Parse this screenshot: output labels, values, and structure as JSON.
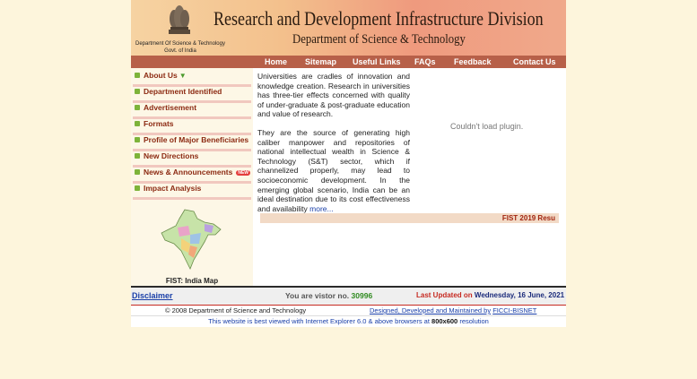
{
  "header": {
    "dept_line1": "Department Of Science & Technology",
    "dept_line2": "Govt. of India",
    "title": "Research and Development Infrastructure Division",
    "subtitle": "Department of Science & Technology"
  },
  "nav": {
    "home": "Home",
    "sitemap": "Sitemap",
    "useful_links": "Useful Links",
    "faqs": "FAQs",
    "feedback": "Feedback",
    "contact": "Contact Us"
  },
  "sidebar": {
    "items": [
      {
        "label": "About Us"
      },
      {
        "label": "Department Identified"
      },
      {
        "label": "Advertisement"
      },
      {
        "label": "Formats"
      },
      {
        "label": "Profile of Major Beneficiaries"
      },
      {
        "label": "New Directions"
      },
      {
        "label": "News & Announcements"
      },
      {
        "label": "Impact Analysis"
      }
    ],
    "new_badge": "NEW",
    "map_label": "FIST: India Map"
  },
  "main": {
    "para1": "Universities are cradles of innovation and knowledge creation. Research in universities has three-tier effects concerned with quality of under-graduate & post-graduate education and value of research.",
    "para2": "They are the source of generating high caliber manpower and repositories of national intellectual wealth in Science & Technology (S&T) sector, which if channelized properly, may lead to socioeconomic development. In the emerging global scenario, India can be an ideal destination due to its cost effectiveness and availability",
    "more": "more...",
    "plugin_msg": "Couldn't load plugin.",
    "ticker": "FIST 2019 Resu"
  },
  "footer": {
    "disclaimer": "Disclaimer",
    "visitor_prefix": "You are vistor no.",
    "visitor_count": "30996",
    "updated_label": "Last Updated on",
    "updated_date": "Wednesday, 16 June, 2021",
    "copyright": "© 2008 Department of Science and Technology",
    "designed_prefix": "Designed, Developed and Maintained by",
    "designed_by": "FICCI-BISNET",
    "best_view_prefix": "This website is best viewed with Internet Explorer 6.0 & above browsers at",
    "best_view_res": "800x600",
    "best_view_suffix": "resolution"
  }
}
